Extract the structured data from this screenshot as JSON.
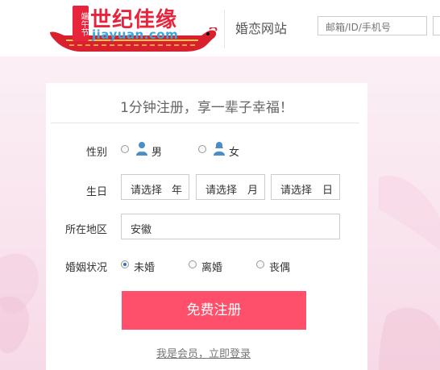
{
  "header": {
    "logo_badge": "端午节",
    "logo_cn": "世纪佳缘",
    "logo_en": "jiayuan.com",
    "site_title": "婚恋网站",
    "login_placeholder": "邮箱/ID/手机号"
  },
  "form": {
    "title": "1分钟注册，享一辈子幸福！",
    "gender": {
      "label": "性别",
      "options": [
        {
          "label": "男",
          "checked": false,
          "icon": "male-icon"
        },
        {
          "label": "女",
          "checked": false,
          "icon": "female-icon"
        }
      ]
    },
    "birthday": {
      "label": "生日",
      "year": {
        "value": "请选择",
        "unit": "年"
      },
      "month": {
        "value": "请选择",
        "unit": "月"
      },
      "day": {
        "value": "请选择",
        "unit": "日"
      }
    },
    "region": {
      "label": "所在地区",
      "value": "安徽"
    },
    "marital": {
      "label": "婚姻状况",
      "options": [
        {
          "label": "未婚",
          "checked": true
        },
        {
          "label": "离婚",
          "checked": false
        },
        {
          "label": "丧偶",
          "checked": false
        }
      ]
    },
    "submit_label": "免费注册",
    "login_link": "我是会员，立即登录"
  },
  "colors": {
    "brand_red": "#e8243c",
    "brand_blue": "#3aa6d9",
    "cta": "#fe4f6b",
    "radio_checked": "#3370b8",
    "background_pink": "#f9e4ee"
  }
}
